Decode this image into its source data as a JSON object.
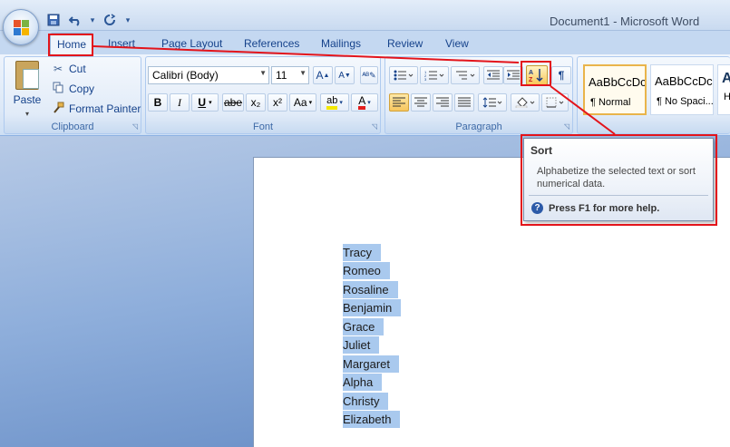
{
  "window": {
    "title": "Document1 - Microsoft Word"
  },
  "qat": {
    "dropdown_glyph": "▾"
  },
  "tabs": [
    {
      "label": "Home",
      "active": true
    },
    {
      "label": "Insert"
    },
    {
      "label": "Page Layout"
    },
    {
      "label": "References"
    },
    {
      "label": "Mailings"
    },
    {
      "label": "Review"
    },
    {
      "label": "View"
    }
  ],
  "clipboard": {
    "group_label": "Clipboard",
    "paste_label": "Paste",
    "cut_label": "Cut",
    "copy_label": "Copy",
    "format_painter_label": "Format Painter"
  },
  "font": {
    "group_label": "Font",
    "family": "Calibri (Body)",
    "size": "11",
    "grow_label": "A",
    "shrink_label": "A",
    "bold": "B",
    "italic": "I",
    "underline": "U",
    "strikethrough": "abe",
    "subscript": "x₂",
    "superscript": "x²",
    "change_case": "Aa",
    "highlight": "ab",
    "font_color": "A"
  },
  "paragraph": {
    "group_label": "Paragraph",
    "show_marks": "¶"
  },
  "styles": [
    {
      "preview": "AaBbCcDc",
      "name": "¶ Normal",
      "selected": true
    },
    {
      "preview": "AaBbCcDc",
      "name": "¶ No Spaci...",
      "selected": false
    },
    {
      "preview": "A",
      "name": "H",
      "selected": false
    }
  ],
  "tooltip": {
    "title": "Sort",
    "description": "Alphabetize the selected text or sort numerical data.",
    "help_text": "Press F1 for more help."
  },
  "document": {
    "lines": [
      "Tracy",
      "Romeo",
      "Rosaline",
      "Benjamin",
      "Grace",
      "Juliet",
      "Margaret",
      "Alpha",
      "Christy",
      "Elizabeth"
    ]
  },
  "colors": {
    "annotation_red": "#e3141b",
    "selection_blue": "#a9c9ee",
    "ribbon_blue": "#dce8f7"
  }
}
